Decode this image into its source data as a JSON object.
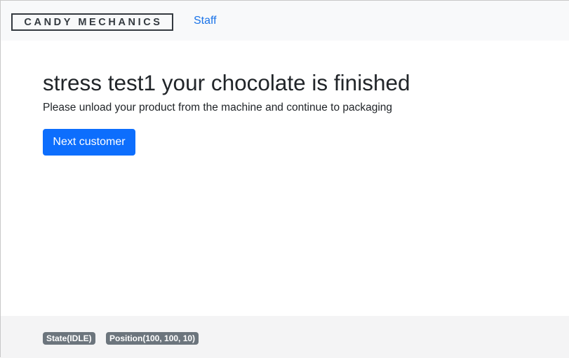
{
  "navbar": {
    "brand": "CANDY MECHANICS",
    "links": [
      {
        "label": "Staff"
      }
    ]
  },
  "main": {
    "title": "stress test1 your chocolate is finished",
    "subtitle": "Please unload your product from the machine and continue to packaging",
    "next_button_label": "Next customer"
  },
  "footer": {
    "state_badge": "State(IDLE)",
    "position_badge": "Position(100, 100, 10)"
  },
  "colors": {
    "primary": "#0d6efd",
    "link": "#1a73e8",
    "badge": "#6c757d",
    "navbar_bg": "#f8f9fa"
  }
}
